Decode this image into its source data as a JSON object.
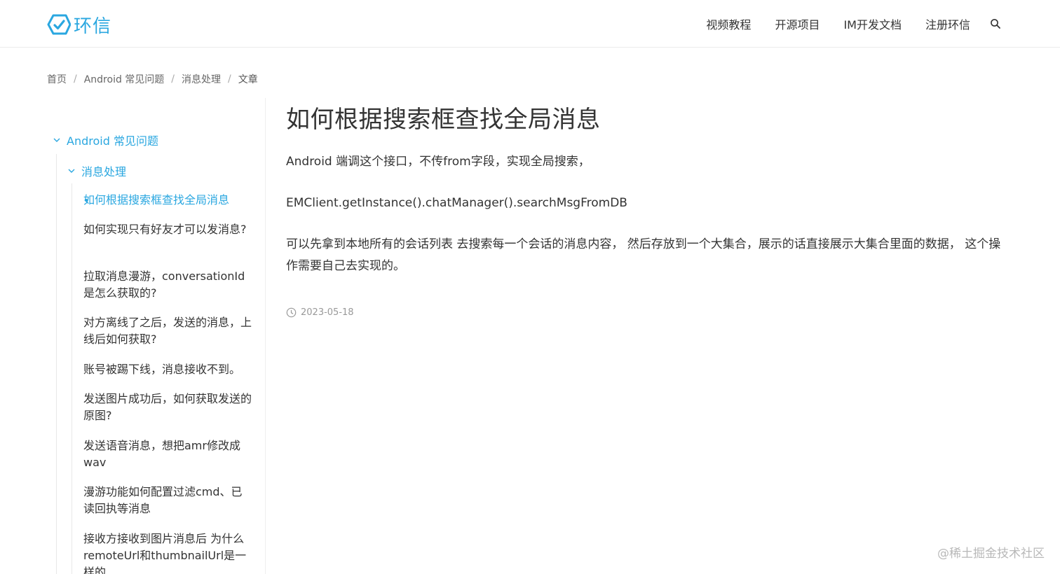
{
  "brand": {
    "name": "环信",
    "color": "#2aa7e0"
  },
  "nav": {
    "items": [
      "视频教程",
      "开源项目",
      "IM开发文档",
      "注册环信"
    ],
    "search_icon": "search-icon"
  },
  "breadcrumb": [
    "首页",
    "Android 常见问题",
    "消息处理",
    "文章"
  ],
  "sidebar": {
    "category": "Android 常见问题",
    "subcategory": "消息处理",
    "items": [
      "如何根据搜索框查找全局消息",
      "如何实现只有好友才可以发消息?",
      "拉取消息漫游，conversationId是怎么获取的?",
      "对方离线了之后，发送的消息，上线后如何获取?",
      "账号被踢下线，消息接收不到。",
      "发送图片成功后，如何获取发送的原图?",
      "发送语音消息，想把amr修改成wav",
      "漫游功能如何配置过滤cmd、已读回执等消息",
      "接收方接收到图片消息后 为什么remoteUrl和thumbnailUrl是一样的"
    ],
    "active_index": 0
  },
  "article": {
    "title": "如何根据搜索框查找全局消息",
    "paragraphs": [
      "Android 端调这个接口，不传from字段，实现全局搜索，",
      "EMClient.getInstance().chatManager().searchMsgFromDB",
      "可以先拿到本地所有的会话列表 去搜索每一个会话的消息内容， 然后存放到一个大集合，展示的话直接展示大集合里面的数据， 这个操作需要自己去实现的。"
    ],
    "date": "2023-05-18"
  },
  "watermark": "@稀土掘金技术社区"
}
